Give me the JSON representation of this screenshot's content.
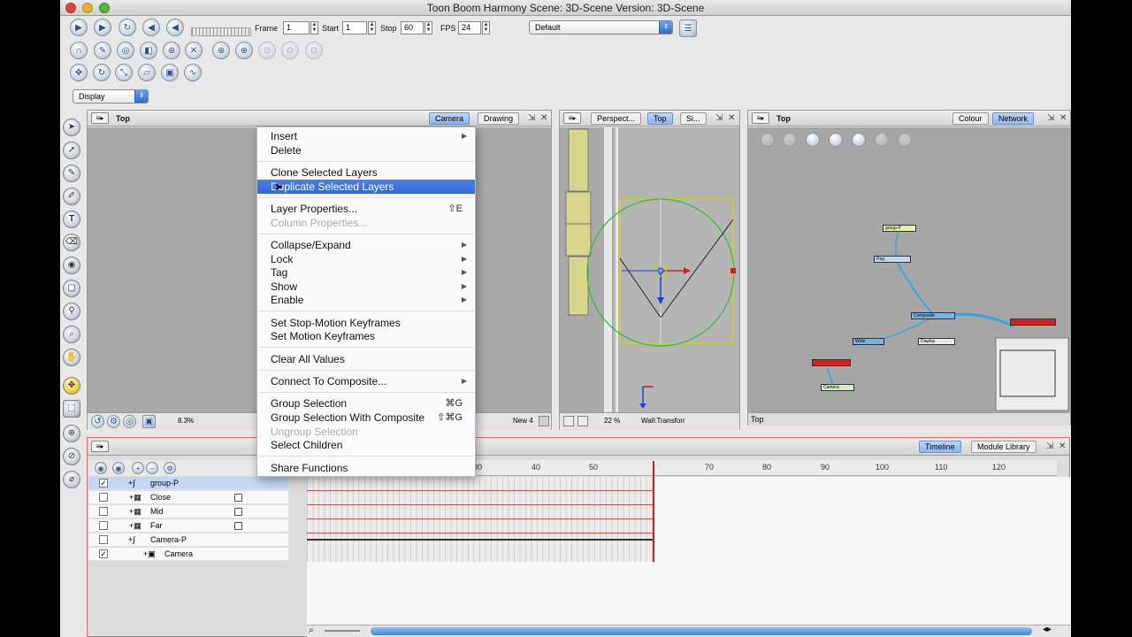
{
  "window": {
    "title": "Toon Boom Harmony Scene: 3D-Scene Version: 3D-Scene"
  },
  "playback": {
    "frame_label": "Frame",
    "frame_value": "1",
    "start_label": "Start",
    "start_value": "1",
    "stop_label": "Stop",
    "stop_value": "60",
    "fps_label": "FPS",
    "fps_value": "24",
    "workspace_value": "Default"
  },
  "display": {
    "value": "Display"
  },
  "camera_view": {
    "title": "Top",
    "tabs": [
      "Camera",
      "Drawing"
    ],
    "zoom": "8.3%",
    "status": "New 4"
  },
  "side_view": {
    "tabs": [
      "Perspect...",
      "Top",
      "Si..."
    ],
    "zoom": "22 %",
    "status": "Wall:Transforr"
  },
  "node_view": {
    "title": "Top",
    "tabs": [
      "Colour",
      "Network"
    ],
    "footer": "Top",
    "nodes": [
      "group-P",
      "Peg",
      "Composite",
      "Write",
      "Display",
      "Camera"
    ]
  },
  "timeline": {
    "tabs": [
      "Timeline",
      "Module Library"
    ],
    "ruler": [
      "30",
      "40",
      "50",
      "70",
      "80",
      "90",
      "100",
      "110",
      "120"
    ],
    "layers": [
      {
        "name": "group-P",
        "checked": "✓"
      },
      {
        "name": "Close",
        "checked": ""
      },
      {
        "name": "Mid",
        "checked": ""
      },
      {
        "name": "Far",
        "checked": ""
      },
      {
        "name": "Camera-P",
        "checked": ""
      },
      {
        "name": "Camera",
        "checked": "✓"
      }
    ]
  },
  "context_menu": {
    "items": [
      {
        "label": "Insert",
        "sub": "▶"
      },
      {
        "label": "Delete"
      },
      {
        "label": "Clone Selected Layers"
      },
      {
        "label": "Duplicate Selected Layers"
      },
      {
        "label": "Layer Properties...",
        "shortcut": "⇧E"
      },
      {
        "label": "Column Properties..."
      },
      {
        "label": "Collapse/Expand",
        "sub": "▶"
      },
      {
        "label": "Lock",
        "sub": "▶"
      },
      {
        "label": "Tag",
        "sub": "▶"
      },
      {
        "label": "Show",
        "sub": "▶"
      },
      {
        "label": "Enable",
        "sub": "▶"
      },
      {
        "label": "Set Stop-Motion Keyframes"
      },
      {
        "label": "Set Motion Keyframes"
      },
      {
        "label": "Clear All Values"
      },
      {
        "label": "Connect To Composite...",
        "sub": "▶"
      },
      {
        "label": "Group Selection",
        "shortcut": "⌘G"
      },
      {
        "label": "Group Selection With Composite",
        "shortcut": "⇧⌘G"
      },
      {
        "label": "Ungroup Selection"
      },
      {
        "label": "Select Children"
      },
      {
        "label": "Share Functions"
      }
    ]
  },
  "colors": {
    "accent": "#3468db",
    "selection_bg": "#c3d7f4",
    "playhead": "#d62020",
    "bounding_box": "#d4d400",
    "camera_circle": "#2fbf2f"
  },
  "icons": [
    "play-icon",
    "loop-icon",
    "sound-icon",
    "select-icon",
    "brush-icon",
    "pencil-icon",
    "text-icon",
    "eraser-icon",
    "zoom-icon",
    "hand-icon",
    "gear-icon"
  ]
}
